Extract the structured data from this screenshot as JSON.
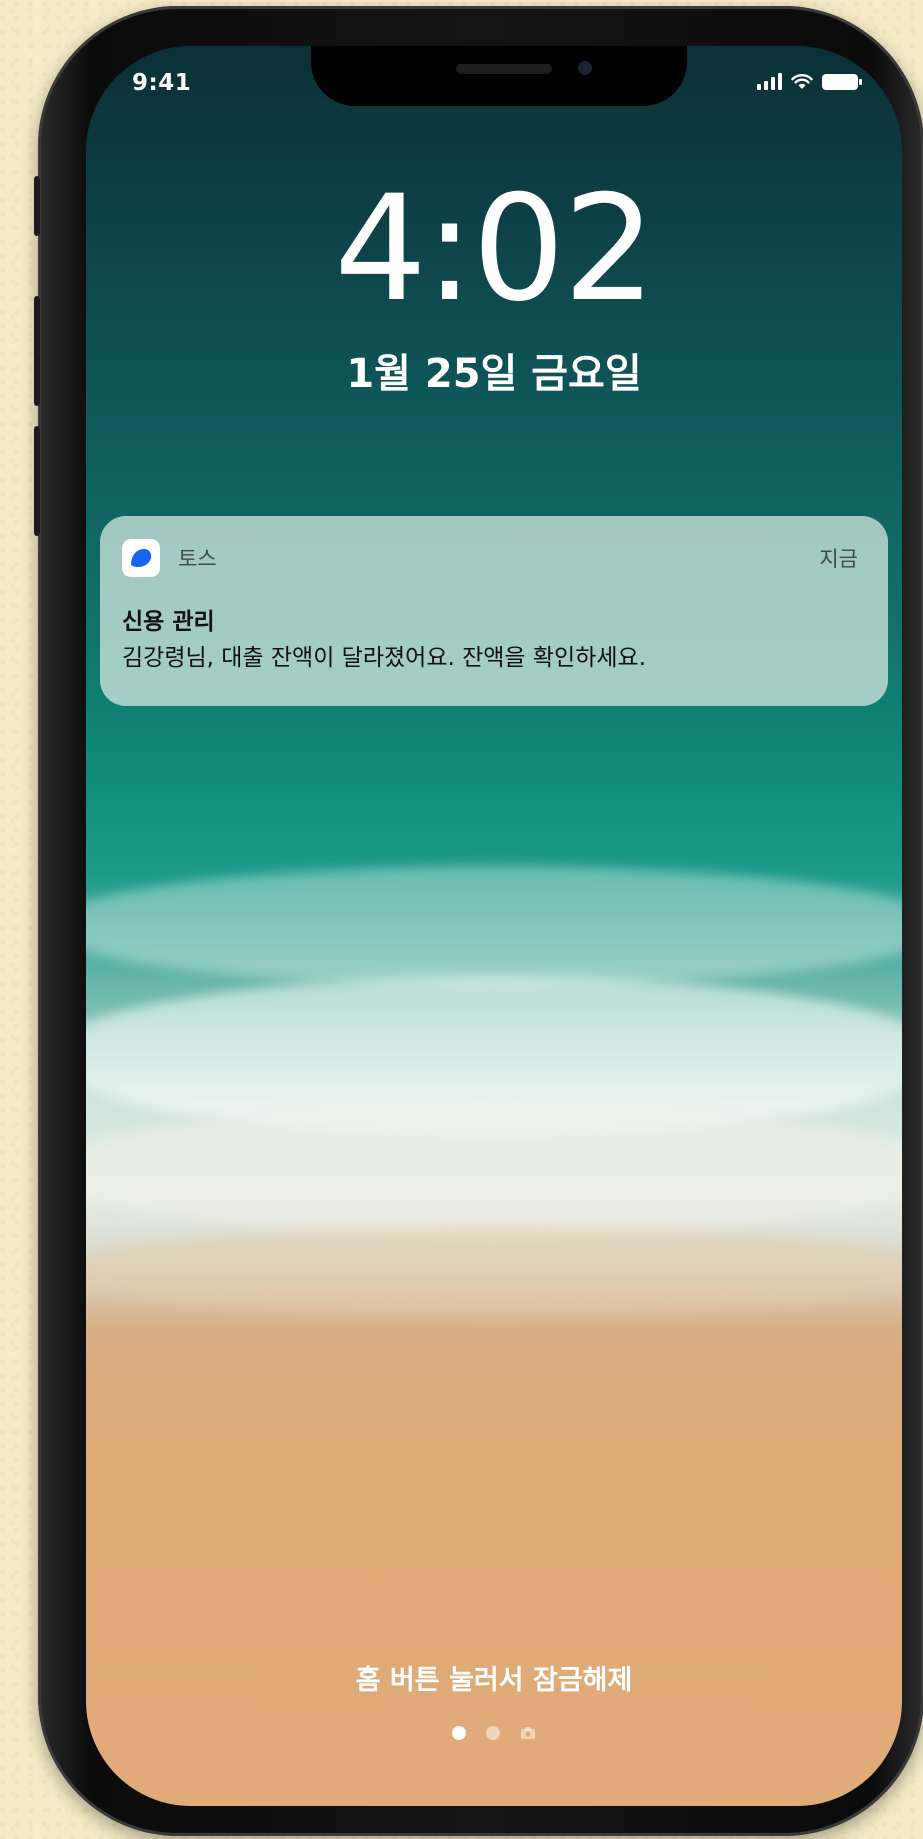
{
  "status_bar": {
    "time": "9:41",
    "icons": [
      "signal-icon",
      "wifi-icon",
      "battery-icon"
    ]
  },
  "lock_screen": {
    "time": "4:02",
    "date": "1월 25일 금요일",
    "unlock_hint": "홈 버튼 눌러서 잠금해제",
    "pager": [
      "page-dot-active",
      "page-dot",
      "camera-icon"
    ]
  },
  "notification": {
    "app_name": "토스",
    "time": "지금",
    "title": "신용 관리",
    "body": "김강령님, 대출 잔액이 달라졌어요. 잔액을 확인하세요.",
    "app_icon": "toss-app-icon"
  },
  "colors": {
    "background": "#f6ecc7",
    "notification": "#cde4de",
    "toss_blue": "#1b64f2"
  }
}
